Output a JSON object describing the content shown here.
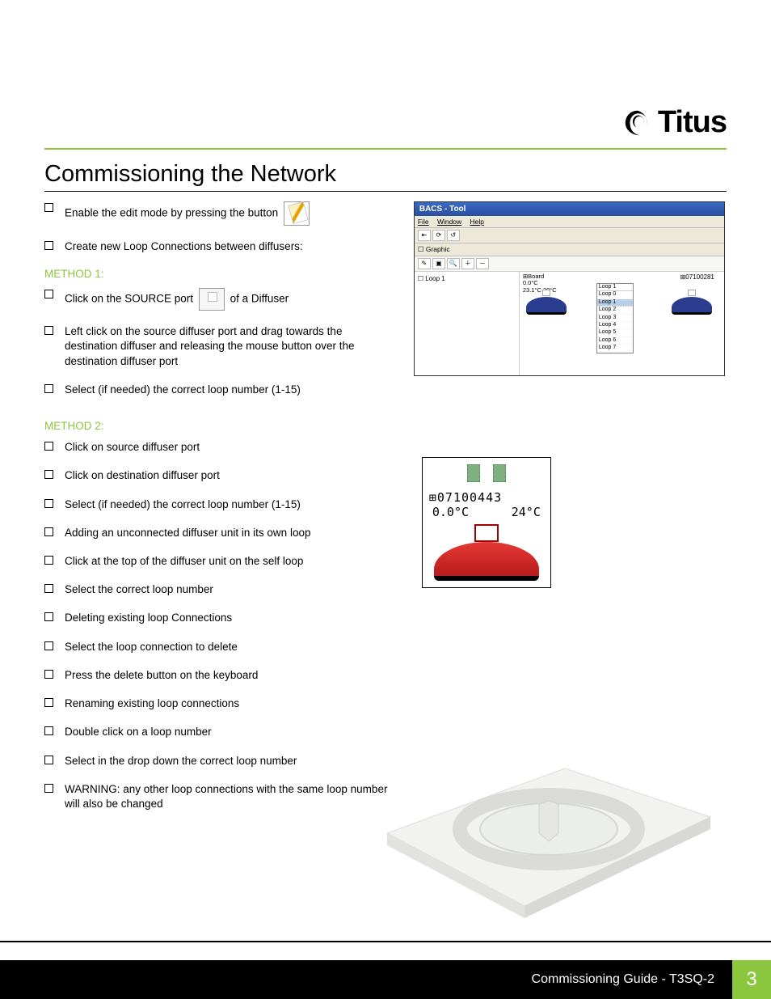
{
  "brand": "Titus",
  "section_title": "Commissioning the Network",
  "left": {
    "intro": [
      "Enable the edit mode by pressing the button",
      "Create new Loop Connections between diffusers:"
    ],
    "method1_label": "METHOD 1:",
    "method1": {
      "click_source_pre": "Click on the SOURCE port",
      "click_source_post": "of a Diffuser",
      "drag": "Left click on the source diffuser port and drag towards the destination diffuser and releasing the mouse button over the destination diffuser port",
      "select_loop": "Select (if needed) the correct loop number (1-15)"
    },
    "method2_label": "METHOD 2:",
    "method2": [
      "Click on source diffuser port",
      "Click on destination diffuser port",
      "Select (if needed) the correct loop number (1-15)",
      "Adding an unconnected diffuser unit in its own loop",
      "Click at the top of the diffuser unit on the self loop",
      "Select the correct loop number",
      "Deleting existing loop Connections",
      "Select the loop connection to delete",
      "Press the delete button on the keyboard",
      "Renaming existing loop connections",
      "Double click on a loop number",
      "Select in the drop down the correct loop number",
      "WARNING: any other loop connections with the same loop number will also be changed"
    ]
  },
  "bacs": {
    "title": "BACS - Tool",
    "menu": {
      "file": "File",
      "window": "Window",
      "help": "Help"
    },
    "graphic_label": "Graphic",
    "tree_item": "Loop 1",
    "board": {
      "label": "Board",
      "line1": "0.0°C",
      "line2": "23.1°C   20°C"
    },
    "right_id": "07100281",
    "loop_list_header": "Loop 1",
    "loops": [
      "Loop 0",
      "Loop 1",
      "Loop 2",
      "Loop 3",
      "Loop 4",
      "Loop 5",
      "Loop 6",
      "Loop 7"
    ]
  },
  "fig2": {
    "id": "07100443",
    "temp1": "0.0°C",
    "temp2": "24°C"
  },
  "footer": {
    "label": "Commissioning Guide - T3SQ-2",
    "page": "3"
  }
}
